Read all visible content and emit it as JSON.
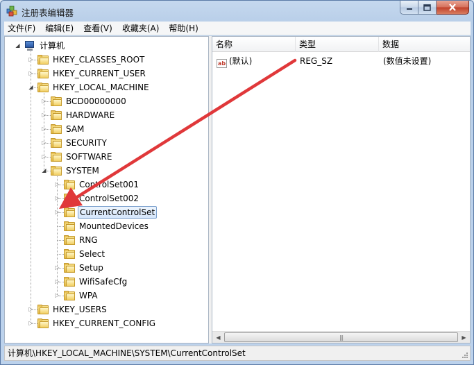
{
  "window": {
    "title": "注册表编辑器"
  },
  "menu": [
    "文件(F)",
    "编辑(E)",
    "查看(V)",
    "收藏夹(A)",
    "帮助(H)"
  ],
  "tree": [
    {
      "label": "计算机",
      "depth": 0,
      "state": "expanded",
      "icon": "computer-icon"
    },
    {
      "label": "HKEY_CLASSES_ROOT",
      "depth": 1,
      "state": "collapsed"
    },
    {
      "label": "HKEY_CURRENT_USER",
      "depth": 1,
      "state": "collapsed"
    },
    {
      "label": "HKEY_LOCAL_MACHINE",
      "depth": 1,
      "state": "expanded"
    },
    {
      "label": "BCD00000000",
      "depth": 2,
      "state": "collapsed"
    },
    {
      "label": "HARDWARE",
      "depth": 2,
      "state": "collapsed"
    },
    {
      "label": "SAM",
      "depth": 2,
      "state": "collapsed"
    },
    {
      "label": "SECURITY",
      "depth": 2,
      "state": "collapsed"
    },
    {
      "label": "SOFTWARE",
      "depth": 2,
      "state": "collapsed"
    },
    {
      "label": "SYSTEM",
      "depth": 2,
      "state": "expanded"
    },
    {
      "label": "ControlSet001",
      "depth": 3,
      "state": "collapsed"
    },
    {
      "label": "ControlSet002",
      "depth": 3,
      "state": "collapsed"
    },
    {
      "label": "CurrentControlSet",
      "depth": 3,
      "state": "collapsed",
      "selected": true
    },
    {
      "label": "MountedDevices",
      "depth": 3,
      "state": "leaf"
    },
    {
      "label": "RNG",
      "depth": 3,
      "state": "leaf"
    },
    {
      "label": "Select",
      "depth": 3,
      "state": "leaf"
    },
    {
      "label": "Setup",
      "depth": 3,
      "state": "collapsed"
    },
    {
      "label": "WifiSafeCfg",
      "depth": 3,
      "state": "collapsed"
    },
    {
      "label": "WPA",
      "depth": 3,
      "state": "collapsed"
    },
    {
      "label": "HKEY_USERS",
      "depth": 1,
      "state": "collapsed"
    },
    {
      "label": "HKEY_CURRENT_CONFIG",
      "depth": 1,
      "state": "collapsed"
    }
  ],
  "list": {
    "columns": [
      "名称",
      "类型",
      "数据"
    ],
    "rows": [
      {
        "name": "(默认)",
        "type": "REG_SZ",
        "data": "(数值未设置)",
        "icon": "string-value-icon",
        "icon_text": "ab"
      }
    ]
  },
  "statusbar": {
    "path": "计算机\\HKEY_LOCAL_MACHINE\\SYSTEM\\CurrentControlSet"
  },
  "colors": {
    "annotation_arrow": "#e0383a",
    "selection_border": "#7da2ce"
  }
}
